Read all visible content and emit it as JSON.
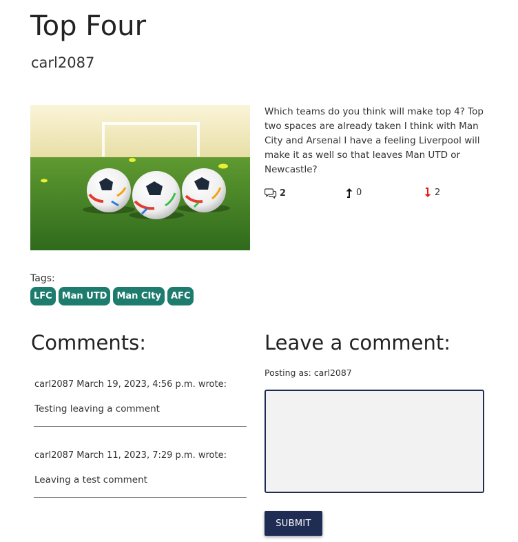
{
  "post": {
    "title": "Top Four",
    "author": "carl2087",
    "content": "Which teams do you think will make top 4? Top two spaces are already taken I think with Man City and Arsenal I have a feeling Liverpool will make it as well so that leaves Man UTD or Newcastle?",
    "image_icon": "football-photo",
    "stats": {
      "comment_count": "2",
      "comment_icon": "comments-icon",
      "upvotes": "0",
      "upvote_icon": "arrow-up-icon",
      "downvotes": "2",
      "downvote_icon": "arrow-down-icon"
    }
  },
  "tags": {
    "label": "Tags:",
    "items": [
      "LFC",
      "Man UTD",
      "Man CIty",
      "AFC"
    ],
    "color": "#1e7c6e"
  },
  "comments_section": {
    "heading": "Comments:",
    "items": [
      {
        "meta": "carl2087 March 19, 2023, 4:56 p.m. wrote:",
        "body": "Testing leaving a comment"
      },
      {
        "meta": "carl2087 March 11, 2023, 7:29 p.m. wrote:",
        "body": "Leaving a test comment"
      }
    ]
  },
  "comment_form": {
    "heading": "Leave a comment:",
    "posting_as": "Posting as: carl2087",
    "textarea_value": "",
    "submit_label": "SUBMIT",
    "accent_color": "#1f2d55"
  }
}
